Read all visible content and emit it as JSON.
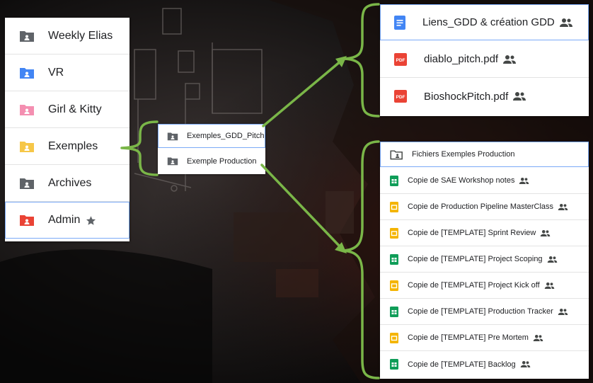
{
  "colors": {
    "accent_green": "#7ab648",
    "folder_dark": "#5f6368",
    "folder_blue": "#4285f4",
    "folder_pink": "#f48fb1",
    "folder_yellow": "#f6c748",
    "folder_red": "#ea4335",
    "doc_blue": "#4285f4",
    "pdf_red": "#ea4335",
    "sheets_green": "#0f9d58",
    "slides_yellow": "#f4b400"
  },
  "left_folders": [
    {
      "label": "Weekly Elias",
      "icon": "shared-folder-icon",
      "color": "#5f6368"
    },
    {
      "label": "VR",
      "icon": "shared-folder-icon",
      "color": "#4285f4"
    },
    {
      "label": "Girl & Kitty",
      "icon": "shared-folder-icon",
      "color": "#f48fb1"
    },
    {
      "label": "Exemples",
      "icon": "shared-folder-icon",
      "color": "#f6c748"
    },
    {
      "label": "Archives",
      "icon": "shared-folder-icon",
      "color": "#5f6368"
    },
    {
      "label": "Admin",
      "icon": "shared-folder-icon",
      "color": "#ea4335",
      "starred": true
    }
  ],
  "mid_folders": [
    {
      "label": "Exemples_GDD_Pitch",
      "icon": "shared-folder-icon"
    },
    {
      "label": "Exemple Production",
      "icon": "shared-folder-icon"
    }
  ],
  "top_right_files": [
    {
      "label": "Liens_GDD & création GDD",
      "icon": "google-docs-icon",
      "shared": true
    },
    {
      "label": "diablo_pitch.pdf",
      "icon": "pdf-icon",
      "icon_text": "PDF",
      "shared": true
    },
    {
      "label": "BioshockPitch.pdf",
      "icon": "pdf-icon",
      "icon_text": "PDF",
      "shared": true
    }
  ],
  "bottom_right_files": [
    {
      "label": "Fichiers Exemples Production",
      "icon": "shared-folder-outline-icon",
      "shared": false
    },
    {
      "label": "Copie de SAE Workshop notes",
      "icon": "google-sheets-icon",
      "shared": true
    },
    {
      "label": "Copie de Production Pipeline MasterClass",
      "icon": "google-slides-icon",
      "shared": true
    },
    {
      "label": "Copie de [TEMPLATE] Sprint Review",
      "icon": "google-slides-icon",
      "shared": true
    },
    {
      "label": "Copie de [TEMPLATE] Project Scoping",
      "icon": "google-sheets-icon",
      "shared": true
    },
    {
      "label": "Copie de [TEMPLATE] Project Kick off",
      "icon": "google-slides-icon",
      "shared": true
    },
    {
      "label": "Copie de [TEMPLATE] Production Tracker",
      "icon": "google-sheets-icon",
      "shared": true
    },
    {
      "label": "Copie de [TEMPLATE] Pre Mortem",
      "icon": "google-slides-icon",
      "shared": true
    },
    {
      "label": "Copie de [TEMPLATE] Backlog",
      "icon": "google-sheets-icon",
      "shared": true
    }
  ]
}
